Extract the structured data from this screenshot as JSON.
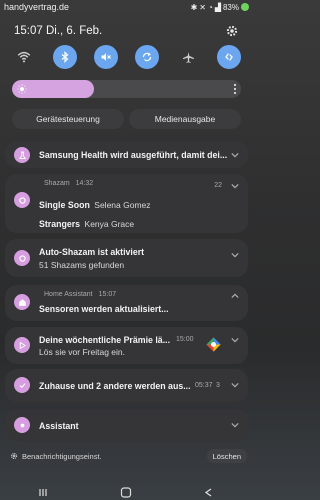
{
  "status": {
    "carrier": "handyvertrag.de",
    "battery": "83%"
  },
  "header": {
    "datetime": "15:07  Di., 6. Feb."
  },
  "brightness": {
    "level": 0.36
  },
  "buttons": {
    "devices": "Gerätesteuerung",
    "media": "Medienausgabe"
  },
  "notifications": {
    "health": {
      "title": "Samsung Health wird ausgeführt, damit dei..."
    },
    "shazam": {
      "app": "Shazam",
      "time": "14:32",
      "count": "22",
      "songs": [
        {
          "title": "Single Soon",
          "artist": "Selena Gomez"
        },
        {
          "title": "Strangers",
          "artist": "Kenya Grace"
        }
      ]
    },
    "autoshazam": {
      "title": "Auto-Shazam ist aktiviert",
      "text": "51 Shazams gefunden"
    },
    "homeassistant": {
      "app": "Home Assistant",
      "time": "15:07",
      "title": "Sensoren werden aktualisiert..."
    },
    "reward": {
      "title": "Deine wöchentliche Prämie lä...",
      "time": "15:00",
      "text": "Lös sie vor Freitag ein."
    },
    "zuhause": {
      "title": "Zuhause und 2 andere werden aus...",
      "time": "05:37",
      "count": "3"
    },
    "assistant": {
      "title": "Assistant"
    }
  },
  "footer": {
    "settings": "Benachrichtigungseinst.",
    "clear": "Löschen"
  },
  "colors": {
    "accent": "#6aa7f0",
    "app_icon": "#d69ee0",
    "brightness": "#d5a3e0"
  }
}
